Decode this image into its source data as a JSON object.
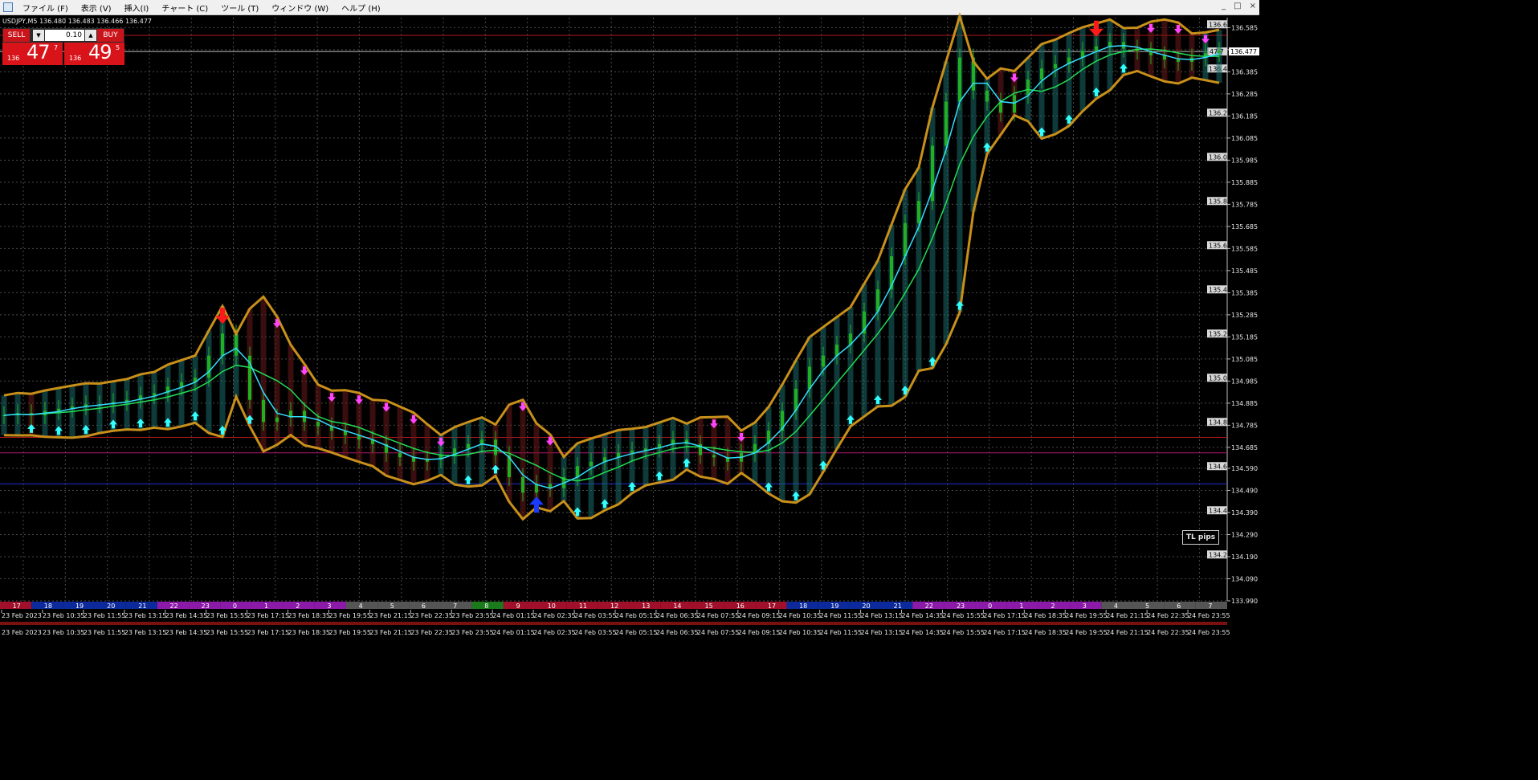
{
  "menu": [
    "ファイル (F)",
    "表示 (V)",
    "挿入(I)",
    "チャート (C)",
    "ツール (T)",
    "ウィンドウ (W)",
    "ヘルプ (H)"
  ],
  "window_controls": [
    "_",
    "□",
    "×"
  ],
  "symbol_line": "USDJPY,M5  136.480 136.483 136.466 136.477",
  "trade_panel": {
    "sell_label": "SELL",
    "buy_label": "BUY",
    "lot": "0.10",
    "sell_price": {
      "prefix": "136",
      "big": "47",
      "sup": "7"
    },
    "buy_price": {
      "prefix": "136",
      "big": "49",
      "sup": "5"
    }
  },
  "tl_pips": "TL pips",
  "colors": {
    "grid": "#4a4a4a",
    "candle_up": "#21b021",
    "band": "#c8901a",
    "ma_fast": "#33ddff",
    "ma_slow": "#22dd55",
    "signal_ma": "#ff33cc",
    "arrow_buy": "#33ffff",
    "arrow_sell": "#ff44ff",
    "arrow_big_sell": "#ff1a1a",
    "arrow_big_buy": "#1a3aff"
  },
  "chart_data": {
    "type": "line",
    "symbol": "USDJPY",
    "timeframe": "M5",
    "current_price": "136.477",
    "price_axis_ticks": [
      "136.585",
      "136.485",
      "136.385",
      "136.285",
      "136.185",
      "136.085",
      "135.985",
      "135.885",
      "135.785",
      "135.685",
      "135.585",
      "135.485",
      "135.385",
      "135.285",
      "135.185",
      "135.085",
      "134.985",
      "134.885",
      "134.785",
      "134.685",
      "134.590",
      "134.490",
      "134.390",
      "134.290",
      "134.190",
      "134.090",
      "133.990"
    ],
    "round_levels": [
      "136.6",
      "136.4",
      "136.2",
      "136.0",
      "135.8",
      "135.6",
      "135.4",
      "135.2",
      "135.0",
      "134.8",
      "134.6",
      "134.4",
      "134.2"
    ],
    "horizontal_lines": [
      {
        "label": "47.7",
        "price": 136.477,
        "color": "#c0c0c0"
      },
      {
        "price": 136.55,
        "color": "#b01818"
      },
      {
        "price": 134.73,
        "color": "#b01818"
      },
      {
        "price": 134.66,
        "color": "#b01870"
      },
      {
        "price": 134.52,
        "color": "#2030d0"
      }
    ],
    "hour_bar": [
      "17",
      "18",
      "19",
      "20",
      "21",
      "22",
      "23",
      "0",
      "1",
      "2",
      "3",
      "4",
      "5",
      "6",
      "7",
      "8",
      "9",
      "10",
      "11",
      "12",
      "13",
      "14",
      "15",
      "16",
      "17",
      "18",
      "19",
      "20",
      "21",
      "22",
      "23",
      "0",
      "1",
      "2",
      "3",
      "4",
      "5",
      "6",
      "7"
    ],
    "time_labels_row1": [
      "23 Feb 2023",
      "23 Feb 10:35",
      "23 Feb 11:55",
      "23 Feb 13:15",
      "23 Feb 14:35",
      "23 Feb 15:55",
      "23 Feb 17:15",
      "23 Feb 18:35",
      "23 Feb 19:55",
      "23 Feb 21:15",
      "23 Feb 22:35",
      "23 Feb 23:55",
      "24 Feb 01:15",
      "24 Feb 02:35",
      "24 Feb 03:55",
      "24 Feb 05:15",
      "24 Feb 06:35",
      "24 Feb 07:55",
      "24 Feb 09:15",
      "24 Feb 10:35",
      "24 Feb 11:55",
      "24 Feb 13:15",
      "24 Feb 14:35",
      "24 Feb 15:55",
      "24 Feb 17:15",
      "24 Feb 18:35",
      "24 Feb 19:55",
      "24 Feb 21:15",
      "24 Feb 22:35",
      "24 Feb 23:55"
    ],
    "time_labels_row2": [
      "23 Feb 2023",
      "23 Feb 10:35",
      "23 Feb 11:55",
      "23 Feb 13:15",
      "23 Feb 14:35",
      "23 Feb 15:55",
      "23 Feb 17:15",
      "23 Feb 18:35",
      "23 Feb 19:55",
      "23 Feb 21:15",
      "23 Feb 22:35",
      "23 Feb 23:55",
      "24 Feb 01:15",
      "24 Feb 02:35",
      "24 Feb 03:55",
      "24 Feb 05:15",
      "24 Feb 06:35",
      "24 Feb 07:55",
      "24 Feb 09:15",
      "24 Feb 10:35",
      "24 Feb 11:55",
      "24 Feb 13:15",
      "24 Feb 14:35",
      "24 Feb 15:55",
      "24 Feb 17:15",
      "24 Feb 18:35",
      "24 Feb 19:55",
      "24 Feb 21:15",
      "24 Feb 22:35",
      "24 Feb 23:55"
    ],
    "series": [
      {
        "values": [
          134.83,
          134.84,
          134.83,
          134.85,
          134.86,
          134.87,
          134.88,
          134.88,
          134.89,
          134.9,
          134.92,
          134.93,
          134.96,
          134.98,
          135.0,
          135.1,
          135.2,
          135.1,
          134.9,
          134.8,
          134.82,
          134.85,
          134.8,
          134.78,
          134.76,
          134.74,
          134.72,
          134.7,
          134.66,
          134.64,
          134.62,
          134.63,
          134.65,
          134.68,
          134.7,
          134.72,
          134.65,
          134.55,
          134.48,
          134.52,
          134.5,
          134.55,
          134.6,
          134.62,
          134.64,
          134.66,
          134.67,
          134.68,
          134.7,
          134.72,
          134.7,
          134.65,
          134.64,
          134.62,
          134.66,
          134.7,
          134.76,
          134.85,
          134.95,
          135.05,
          135.1,
          135.15,
          135.2,
          135.3,
          135.4,
          135.55,
          135.7,
          135.8,
          136.05,
          136.25,
          136.45,
          136.3,
          136.25,
          136.2,
          136.28,
          136.35,
          136.4,
          136.42,
          136.45,
          136.48,
          136.5,
          136.52,
          136.49,
          136.48,
          136.46,
          136.44,
          136.43,
          136.45,
          136.47,
          136.48
        ]
      }
    ]
  }
}
